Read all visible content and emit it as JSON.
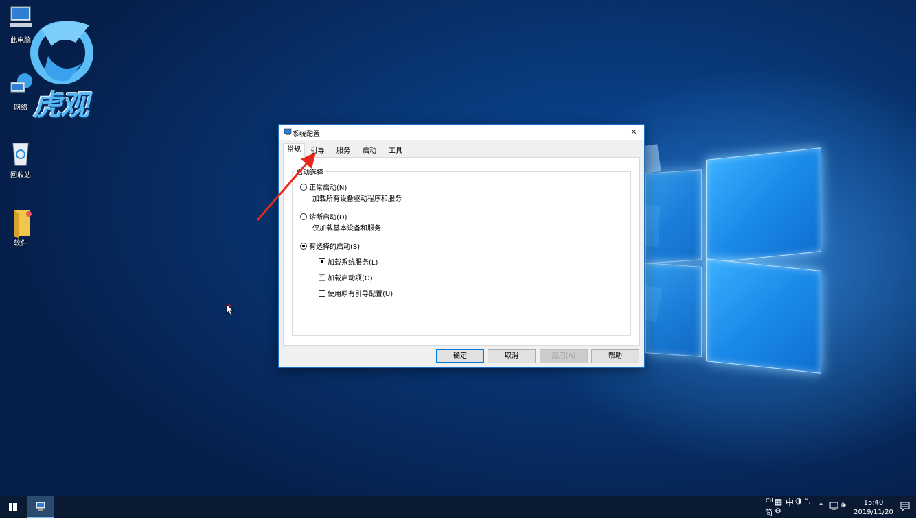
{
  "desktop": {
    "icons": [
      {
        "label": "此电脑"
      },
      {
        "label": "网络"
      },
      {
        "label": "回收站"
      },
      {
        "label": "软件"
      }
    ],
    "watermark": "虎观"
  },
  "dialog": {
    "title": "系统配置",
    "close": "✕",
    "tabs": [
      "常规",
      "引导",
      "服务",
      "启动",
      "工具"
    ],
    "active_tab": "常规",
    "group_label": "启动选择",
    "options": {
      "normal": {
        "label": "正常启动(N)",
        "desc": "加载所有设备驱动程序和服务",
        "selected": false
      },
      "diagnostic": {
        "label": "诊断启动(D)",
        "desc": "仅加载基本设备和服务",
        "selected": false
      },
      "selective": {
        "label": "有选择的启动(S)",
        "selected": true
      }
    },
    "checkboxes": {
      "load_services": {
        "label": "加载系统服务(L)",
        "state": "indeterminate"
      },
      "load_startup": {
        "label": "加载启动项(O)",
        "state": "checked-disabled"
      },
      "use_boot_config": {
        "label": "使用原有引导配置(U)",
        "state": "unchecked"
      }
    },
    "buttons": {
      "ok": "确定",
      "cancel": "取消",
      "apply": "应用(A)",
      "help": "帮助"
    }
  },
  "taskbar": {
    "ime_top": "CH",
    "ime_mode": "中",
    "ime_bottom": "简",
    "time": "15:40",
    "date": "2019/11/20"
  },
  "colors": {
    "accent": "#0078d7",
    "annotation_arrow": "#e8281e"
  }
}
